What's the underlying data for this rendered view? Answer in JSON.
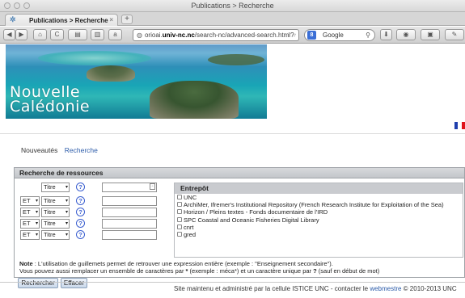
{
  "window": {
    "title": "Publications > Recherche"
  },
  "tabs": [
    {
      "label": "Publications > Recherche",
      "close": "×"
    }
  ],
  "newtab_label": "+",
  "toolbar": {
    "back": "◀",
    "forward": "▶",
    "home": "⌂",
    "reload": "C",
    "history": "▤",
    "bookmarks": "▥",
    "amazon": "a",
    "url_prefix": "orioai.",
    "url_domain": "univ-nc.nc",
    "url_path": "/search-nc/advanced-search.html?",
    "url_star": "☆ ▿",
    "search_engine": "Google",
    "search_badge": "8",
    "download": "⬇",
    "addon1": "◉",
    "addon2": "▣",
    "addon3": "✎"
  },
  "banner": {
    "line1": "Nouvelle",
    "line2": "Calédonie"
  },
  "flag_colors": [
    "#1f3fae",
    "#ffffff",
    "#e0121a"
  ],
  "nav": {
    "item1": "Nouveautés",
    "item2": "Recherche"
  },
  "search": {
    "heading": "Recherche de ressources",
    "rows": [
      {
        "op": "",
        "field": "Titre",
        "help": "?"
      },
      {
        "op": "ET",
        "field": "Titre",
        "help": "?"
      },
      {
        "op": "ET",
        "field": "Titre",
        "help": "?"
      },
      {
        "op": "ET",
        "field": "Titre",
        "help": "?"
      },
      {
        "op": "ET",
        "field": "Titre",
        "help": "?"
      }
    ],
    "arrow": "▾",
    "clear_glyph": "☐"
  },
  "repository": {
    "heading": "Entrepôt",
    "items": [
      "UNC",
      "ArchiMer, Ifremer's Institutional Repository (French Research Institute for Exploitation of the Sea)",
      "Horizon / Pleins textes - Fonds documentaire de l'IRD",
      "SPC Coastal and Oceanic Fisheries Digital Library",
      "cnrt",
      "gred"
    ]
  },
  "note": {
    "label": "Note",
    "line1": " : L'utilisation de guillemets permet de retrouver une expression entière (exemple : \"Enseignement secondaire\").",
    "line2a": "Vous pouvez aussi remplacer un ensemble de caractères par ",
    "star": "*",
    "line2b": " (exemple : méca*) et un caractère unique par ",
    "qmark": "?",
    "line2c": " (sauf en début de mot)"
  },
  "buttons": {
    "search": "Rechercher",
    "clear": "Effacer"
  },
  "footer": {
    "text_before": "Site maintenu et administré par la cellule ISTICE UNC - contacter le ",
    "link": "webmestre",
    "text_after": " © 2010-2013 UNC"
  }
}
